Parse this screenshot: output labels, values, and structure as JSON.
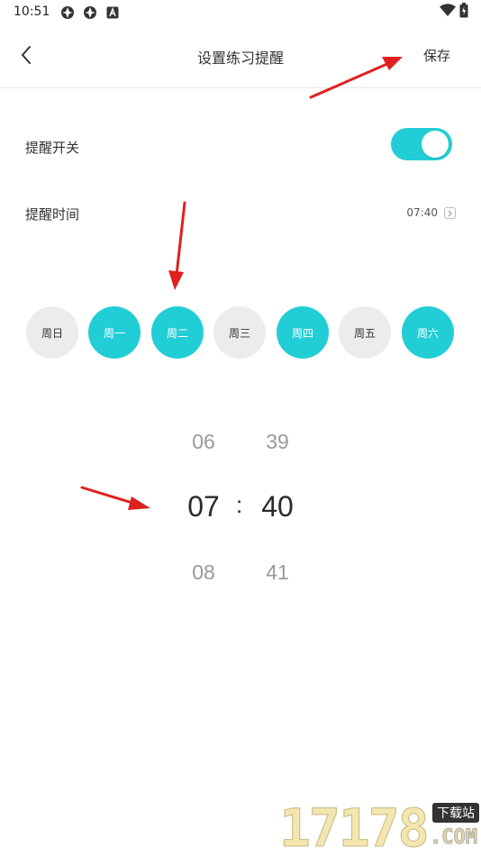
{
  "status_bar": {
    "time": "10:51",
    "left_icons": [
      "app-notification-icon",
      "app-notification-icon",
      "a-letter-icon"
    ],
    "right_icons": [
      "wifi-icon",
      "battery-icon"
    ]
  },
  "header": {
    "back_icon": "chevron-left-icon",
    "title": "设置练习提醒",
    "save_label": "保存"
  },
  "reminder_switch": {
    "label": "提醒开关",
    "on": true,
    "accent_color": "#22ced6"
  },
  "reminder_time": {
    "label": "提醒时间",
    "value": "07:40",
    "arrow_icon": "chevron-right-box-icon"
  },
  "days": [
    {
      "label": "周日",
      "selected": false
    },
    {
      "label": "周一",
      "selected": true
    },
    {
      "label": "周二",
      "selected": true
    },
    {
      "label": "周三",
      "selected": false
    },
    {
      "label": "周四",
      "selected": true
    },
    {
      "label": "周五",
      "selected": false
    },
    {
      "label": "周六",
      "selected": true
    }
  ],
  "picker": {
    "hours": {
      "prev": "06",
      "selected": "07",
      "next": "08"
    },
    "separator": ":",
    "minutes": {
      "prev": "39",
      "selected": "40",
      "next": "41"
    }
  },
  "watermark": {
    "digits": "17178",
    "badge": "下载站",
    "suffix": ".COM"
  },
  "colors": {
    "accent": "#22ced6",
    "chip_off": "#ececec",
    "annotation_arrow": "#e02020"
  }
}
